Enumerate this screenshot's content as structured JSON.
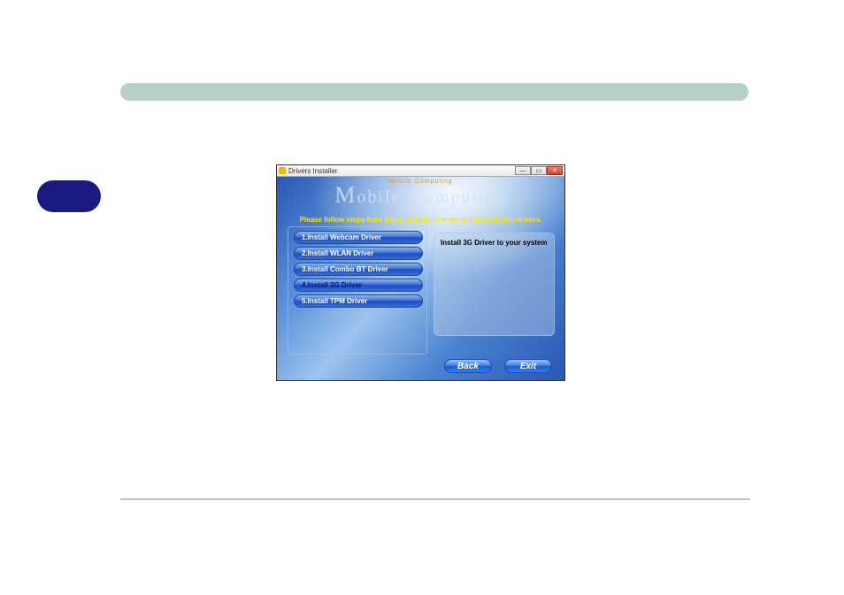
{
  "window": {
    "title": "Drivers Installer",
    "logo_small": "Mobile Computing",
    "logo_big_1": "M",
    "logo_big_2": "obile ",
    "logo_big_3": "C",
    "logo_big_4": "omputing",
    "instruction": "Please follow steps from top to bottom in order to install Option drivers."
  },
  "drivers": [
    {
      "label": "1.Install Webcam Driver",
      "selected": false
    },
    {
      "label": "2.Install WLAN Driver",
      "selected": false
    },
    {
      "label": "3.Install Combo BT Driver",
      "selected": false
    },
    {
      "label": "4.Install 3G Driver",
      "selected": true
    },
    {
      "label": "5.Install TPM Driver",
      "selected": false
    }
  ],
  "info_text": "Install 3G Driver to your system",
  "buttons": {
    "back": "Back",
    "exit": "Exit"
  },
  "title_controls": {
    "minimize_glyph": "—",
    "maximize_glyph": "▭",
    "close_glyph": "✕"
  }
}
